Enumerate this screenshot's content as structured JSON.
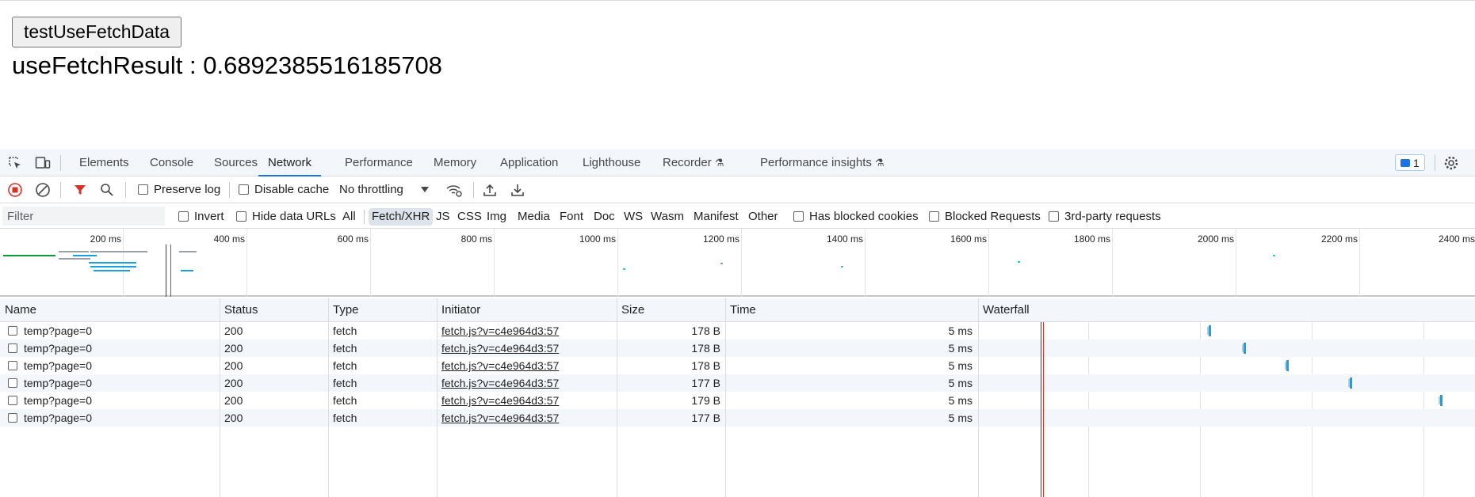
{
  "page": {
    "button_label": "testUseFetchData",
    "result_text": "useFetchResult : 0.6892385516185708"
  },
  "devtools": {
    "tabs": [
      "Elements",
      "Console",
      "Sources",
      "Network",
      "Performance",
      "Memory",
      "Application",
      "Lighthouse",
      "Recorder",
      "Performance insights"
    ],
    "active_tab": "Network",
    "issues_count": "1",
    "toolbar": {
      "preserve_log": "Preserve log",
      "disable_cache": "Disable cache",
      "throttling": "No throttling"
    },
    "filter": {
      "placeholder": "Filter",
      "invert": "Invert",
      "hide_data_urls": "Hide data URLs",
      "types": [
        "All",
        "Fetch/XHR",
        "JS",
        "CSS",
        "Img",
        "Media",
        "Font",
        "Doc",
        "WS",
        "Wasm",
        "Manifest",
        "Other"
      ],
      "active_type": "Fetch/XHR",
      "has_blocked_cookies": "Has blocked cookies",
      "blocked_requests": "Blocked Requests",
      "third_party": "3rd-party requests"
    },
    "overview_ticks": [
      "200 ms",
      "400 ms",
      "600 ms",
      "800 ms",
      "1000 ms",
      "1200 ms",
      "1400 ms",
      "1600 ms",
      "1800 ms",
      "2000 ms",
      "2200 ms",
      "2400 ms"
    ],
    "columns": [
      "Name",
      "Status",
      "Type",
      "Initiator",
      "Size",
      "Time",
      "Waterfall"
    ],
    "rows": [
      {
        "name": "temp?page=0",
        "status": "200",
        "type": "fetch",
        "initiator": "fetch.js?v=c4e964d3:57",
        "size": "178 B",
        "time": "5 ms"
      },
      {
        "name": "temp?page=0",
        "status": "200",
        "type": "fetch",
        "initiator": "fetch.js?v=c4e964d3:57",
        "size": "178 B",
        "time": "5 ms"
      },
      {
        "name": "temp?page=0",
        "status": "200",
        "type": "fetch",
        "initiator": "fetch.js?v=c4e964d3:57",
        "size": "178 B",
        "time": "5 ms"
      },
      {
        "name": "temp?page=0",
        "status": "200",
        "type": "fetch",
        "initiator": "fetch.js?v=c4e964d3:57",
        "size": "177 B",
        "time": "5 ms"
      },
      {
        "name": "temp?page=0",
        "status": "200",
        "type": "fetch",
        "initiator": "fetch.js?v=c4e964d3:57",
        "size": "179 B",
        "time": "5 ms"
      },
      {
        "name": "temp?page=0",
        "status": "200",
        "type": "fetch",
        "initiator": "fetch.js?v=c4e964d3:57",
        "size": "177 B",
        "time": "5 ms"
      }
    ]
  }
}
